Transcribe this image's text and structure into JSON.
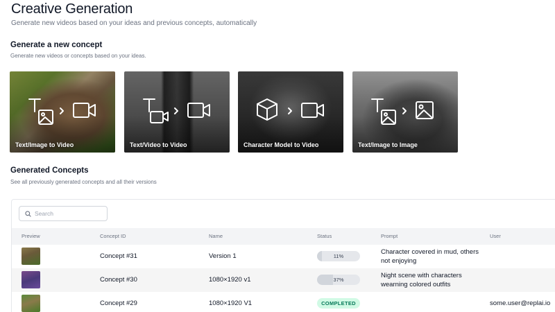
{
  "header": {
    "title": "Creative Generation",
    "subtitle": "Generate new videos based on your ideas and previous concepts, automatically"
  },
  "new_concept": {
    "title": "Generate a new concept",
    "subtitle": "Generate new videos or concepts based on your ideas.",
    "cards": [
      {
        "label": "Text/Image to Video",
        "icons": [
          "text-icon",
          "image-icon",
          "video-icon"
        ]
      },
      {
        "label": "Text/Video to Video",
        "icons": [
          "text-icon",
          "video-icon",
          "video-icon"
        ]
      },
      {
        "label": "Character Model to Video",
        "icons": [
          "cube-icon",
          "video-icon"
        ]
      },
      {
        "label": "Text/Image to Image",
        "icons": [
          "text-icon",
          "image-icon",
          "image-icon"
        ]
      }
    ]
  },
  "generated": {
    "title": "Generated Concepts",
    "subtitle": "See all previously generated concepts and all their versions"
  },
  "search": {
    "placeholder": "Search",
    "value": ""
  },
  "table": {
    "columns": {
      "preview": "Preview",
      "concept_id": "Concept ID",
      "name": "Name",
      "status": "Status",
      "prompt": "Prompt",
      "user": "User"
    },
    "rows": [
      {
        "concept_id": "Concept #31",
        "name": "Version 1",
        "status": "11%",
        "progress": 0.11,
        "prompt_line1": "Character covered in mud, others",
        "prompt_line2": "not enjoying",
        "user": ""
      },
      {
        "concept_id": "Concept #30",
        "name": "1080×1920 v1",
        "status": "37%",
        "progress": 0.37,
        "prompt_line1": "Night scene with characters",
        "prompt_line2": "wearning colored outfits",
        "user": ""
      },
      {
        "concept_id": "Concept #29",
        "name": "1080×1920 V1",
        "status": "COMPLETED",
        "progress": 1.0,
        "prompt_line1": "",
        "prompt_line2": "",
        "user": "some.user@replai.io"
      }
    ]
  },
  "colors": {
    "completed_bg": "#d1fae5",
    "completed_text": "#047857",
    "progress_bg": "#e5e7eb"
  }
}
